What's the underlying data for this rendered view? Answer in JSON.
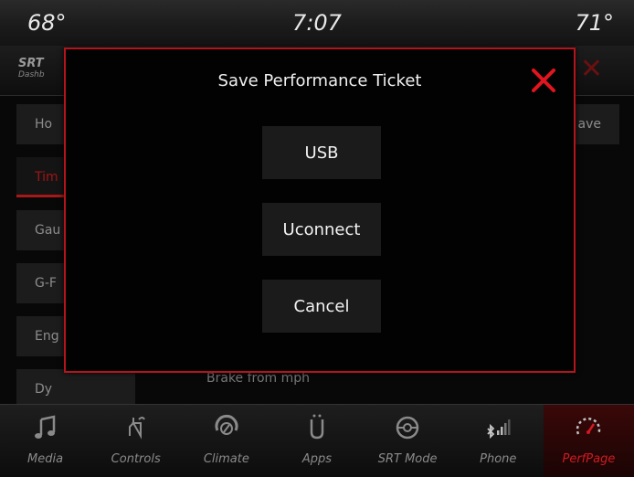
{
  "status": {
    "temp_left": "68°",
    "time": "7:07",
    "temp_right": "71°"
  },
  "background": {
    "logo_line1": "SRT",
    "logo_line2": "Dashb",
    "list_items": [
      "Ho",
      "Tim",
      "Gau",
      "G-F",
      "Eng",
      "Dy"
    ],
    "save_label": "ave",
    "caption": "Brake from mph"
  },
  "modal": {
    "title": "Save Performance Ticket",
    "buttons": {
      "usb": "USB",
      "uconnect": "Uconnect",
      "cancel": "Cancel"
    }
  },
  "nav": {
    "items": [
      {
        "label": "Media",
        "icon": "music-note-icon"
      },
      {
        "label": "Controls",
        "icon": "seat-hand-icon"
      },
      {
        "label": "Climate",
        "icon": "climate-fan-icon"
      },
      {
        "label": "Apps",
        "icon": "apps-icon"
      },
      {
        "label": "SRT Mode",
        "icon": "steering-wheel-icon"
      },
      {
        "label": "Phone",
        "icon": "bluetooth-signal-icon"
      },
      {
        "label": "PerfPage",
        "icon": "speedometer-icon"
      }
    ]
  },
  "colors": {
    "accent": "#b4141b",
    "active_label": "#d11a22"
  }
}
